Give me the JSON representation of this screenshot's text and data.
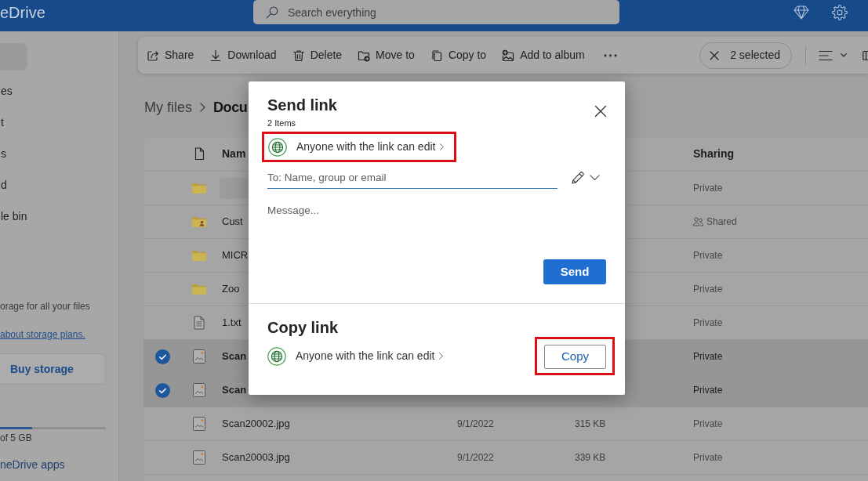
{
  "header": {
    "app_name": "eDrive",
    "search": {
      "placeholder": "Search everything"
    }
  },
  "sidebar": {
    "nav_items": [
      {
        "label": "es"
      },
      {
        "label": "t"
      },
      {
        "label": "s"
      },
      {
        "label": "d"
      },
      {
        "label": "le bin"
      }
    ],
    "storage": {
      "promo": "orage for all your files",
      "plans_link": "about storage plans.",
      "buy_button": "Buy storage",
      "level": 0.3,
      "usage": "of 5 GB"
    },
    "apps_link": "neDrive apps"
  },
  "toolbar": {
    "actions": [
      {
        "label": "Share"
      },
      {
        "label": "Download"
      },
      {
        "label": "Delete"
      },
      {
        "label": "Move to"
      },
      {
        "label": "Copy to"
      },
      {
        "label": "Add to album"
      }
    ],
    "selection": "2 selected"
  },
  "breadcrumb": [
    {
      "label": "My files",
      "current": false
    },
    {
      "label": "Docu",
      "current": true
    }
  ],
  "table": {
    "header": {
      "name": "Nam",
      "sharing": "Sharing"
    },
    "rows": [
      {
        "kind": "folder",
        "shared": false,
        "selected": false,
        "sharing": "Private"
      },
      {
        "kind": "folder",
        "name": "Cust",
        "shared": true,
        "selected": false,
        "sharing": "Shared"
      },
      {
        "kind": "folder",
        "name": "MICR",
        "shared": false,
        "selected": false,
        "sharing": "Private"
      },
      {
        "kind": "folder",
        "name": "Zoo",
        "shared": false,
        "selected": false,
        "sharing": "Private"
      },
      {
        "kind": "text",
        "name": "1.txt",
        "shared": false,
        "selected": false,
        "sharing": "Private"
      },
      {
        "kind": "image",
        "name": "Scan",
        "shared": false,
        "selected": true,
        "sharing": "Private"
      },
      {
        "kind": "image",
        "name": "Scan",
        "shared": false,
        "selected": true,
        "sharing": "Private"
      },
      {
        "kind": "image",
        "name": "Scan20002.jpg",
        "modified": "9/1/2022",
        "size": "315 KB",
        "shared": false,
        "selected": false,
        "sharing": "Private"
      },
      {
        "kind": "image",
        "name": "Scan20003.jpg",
        "modified": "9/1/2022",
        "size": "339 KB",
        "shared": false,
        "selected": false,
        "sharing": "Private"
      }
    ]
  },
  "dialog": {
    "title": "Send link",
    "item_count": "2 Items",
    "link_setting": {
      "label": "Anyone with the link can edit",
      "highlighted": true
    },
    "to_field": {
      "placeholder": "To: Name, group or email"
    },
    "message_field": {
      "placeholder": "Message..."
    },
    "send_button": "Send",
    "copy_section": {
      "title": "Copy link",
      "link_setting": {
        "label": "Anyone with the link can edit",
        "highlighted": false
      },
      "copy_button": {
        "label": "Copy",
        "highlighted": true
      }
    }
  }
}
